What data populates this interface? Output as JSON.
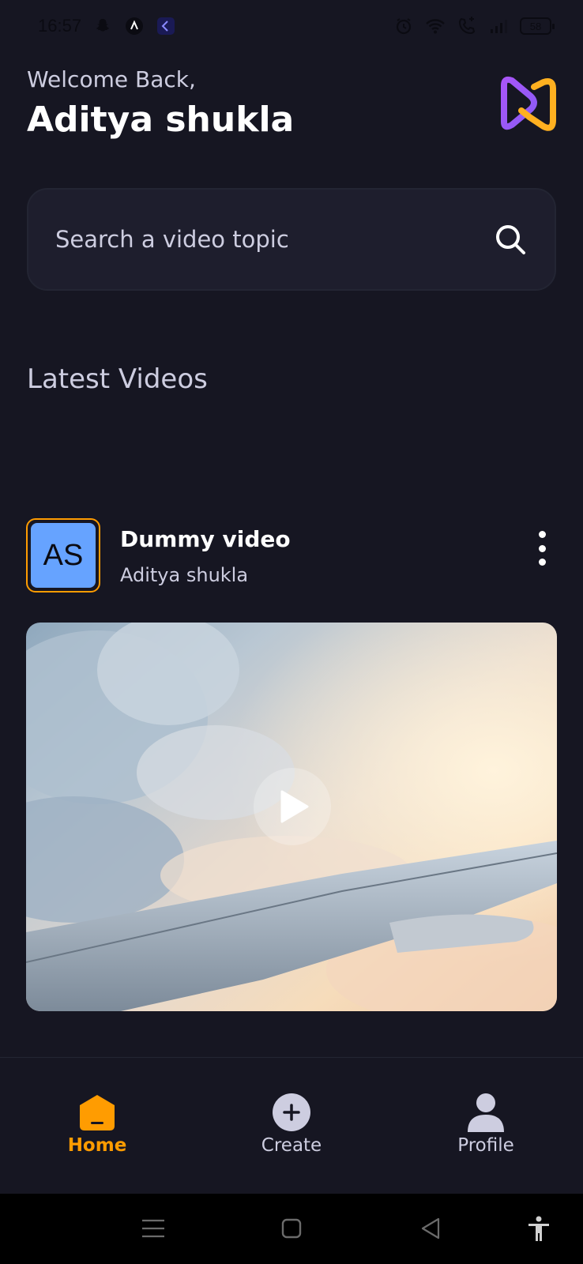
{
  "status_bar": {
    "time": "16:57",
    "battery": "58",
    "icons": [
      "snapchat-icon",
      "app-icon",
      "app-icon-2",
      "alarm-icon",
      "wifi-icon",
      "call-icon",
      "signal-icon",
      "battery-icon"
    ]
  },
  "header": {
    "welcome": "Welcome Back,",
    "username": "Aditya shukla"
  },
  "search": {
    "placeholder": "Search a video topic"
  },
  "latest_videos": {
    "title": "Latest Videos",
    "items": [
      {
        "avatar_initials": "AS",
        "title": "Dummy video",
        "author": "Aditya shukla"
      }
    ]
  },
  "bottom_nav": {
    "items": [
      {
        "label": "Home",
        "icon": "home-icon",
        "active": true
      },
      {
        "label": "Create",
        "icon": "plus-circle-icon",
        "active": false
      },
      {
        "label": "Profile",
        "icon": "profile-icon",
        "active": false
      }
    ]
  },
  "colors": {
    "background": "#161622",
    "accent": "#ff9c01",
    "search_bg": "#1e1e2d",
    "text_secondary": "#cdcde0",
    "avatar_bg": "#66a3ff"
  }
}
